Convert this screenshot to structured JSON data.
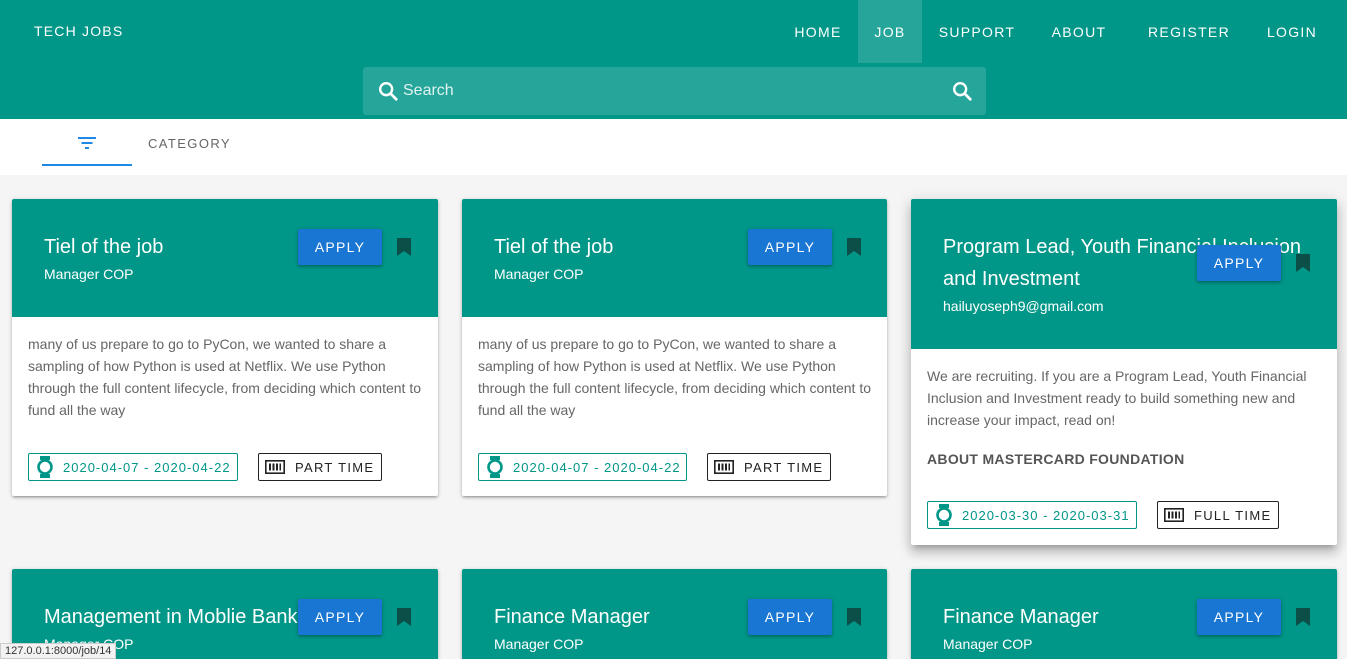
{
  "app": {
    "brand": "TECH JOBS"
  },
  "nav": {
    "home": "HOME",
    "job": "JOB",
    "support": "SUPPORT",
    "about": "ABOUT",
    "register": "REGISTER",
    "login": "LOGIN"
  },
  "search": {
    "placeholder": "Search",
    "value": ""
  },
  "tabs": {
    "category": "CATEGORY"
  },
  "apply_label": "APPLY",
  "jobs": [
    {
      "title": "Tiel of the job",
      "subtitle": "Manager COP",
      "description": "many of us prepare to go to PyCon, we wanted to share a sampling of how Python is used at Netflix. We use Python through the full content lifecycle, from deciding which content to fund all the way",
      "dates": "2020-04-07 - 2020-04-22",
      "type": "PART TIME"
    },
    {
      "title": "Tiel of the job",
      "subtitle": "Manager COP",
      "description": "many of us prepare to go to PyCon, we wanted to share a sampling of how Python is used at Netflix. We use Python through the full content lifecycle, from deciding which content to fund all the way",
      "dates": "2020-04-07 - 2020-04-22",
      "type": "PART TIME"
    },
    {
      "title": "Program Lead, Youth Financial Inclusion and Investment",
      "subtitle": "hailuyoseph9@gmail.com",
      "description": "We are recruiting. If you are a Program Lead, Youth Financial Inclusion and Investment ready to build something new and increase your impact, read on!",
      "extra": "ABOUT MASTERCARD FOUNDATION",
      "dates": "2020-03-30 - 2020-03-31",
      "type": "FULL TIME"
    },
    {
      "title": "Management in Moblie Banking",
      "subtitle": "Manager COP"
    },
    {
      "title": "Finance Manager",
      "subtitle": "Manager COP"
    },
    {
      "title": "Finance Manager",
      "subtitle": "Manager COP"
    }
  ],
  "status_url": "127.0.0.1:8000/job/14",
  "colors": {
    "primary": "#009688",
    "primary_light": "#26a69a",
    "apply": "#1976d2",
    "tab_indicator": "#1e88e5"
  },
  "icons": {
    "search": "search-icon",
    "filter": "filter-icon",
    "bookmark": "bookmark-icon",
    "watch": "watch-icon",
    "barcode": "barcode-icon"
  }
}
